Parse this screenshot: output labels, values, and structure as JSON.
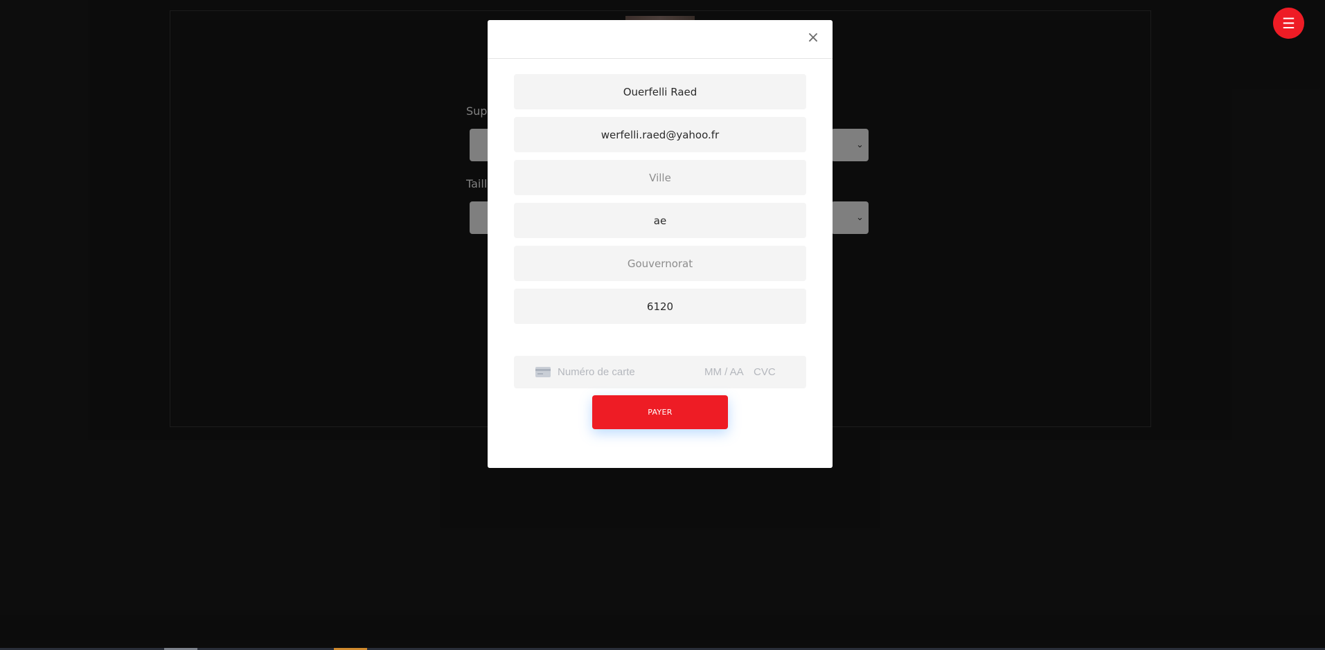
{
  "background": {
    "labels": [
      "Supp",
      "Taille"
    ]
  },
  "menu": {
    "icon": "hamburger-icon",
    "glyph": "☰",
    "color": "#ee1c25"
  },
  "modal": {
    "close_glyph": "×",
    "fields": {
      "name": {
        "value": "Ouerfelli Raed",
        "placeholder": ""
      },
      "email": {
        "value": "werfelli.raed@yahoo.fr",
        "placeholder": ""
      },
      "city": {
        "value": "",
        "placeholder": "Ville"
      },
      "address": {
        "value": "ae",
        "placeholder": ""
      },
      "governorate": {
        "value": "",
        "placeholder": "Gouvernorat"
      },
      "postal_code": {
        "value": "6120",
        "placeholder": ""
      }
    },
    "card": {
      "icon": "credit-card-icon",
      "number_placeholder": "Numéro de carte",
      "expiry_placeholder": "MM / AA",
      "cvc_placeholder": "CVC"
    },
    "pay_label": "PAYER"
  },
  "colors": {
    "accent": "#ee1c25",
    "overlay": "#0e0e0e",
    "field_bg": "#f4f4f4"
  }
}
